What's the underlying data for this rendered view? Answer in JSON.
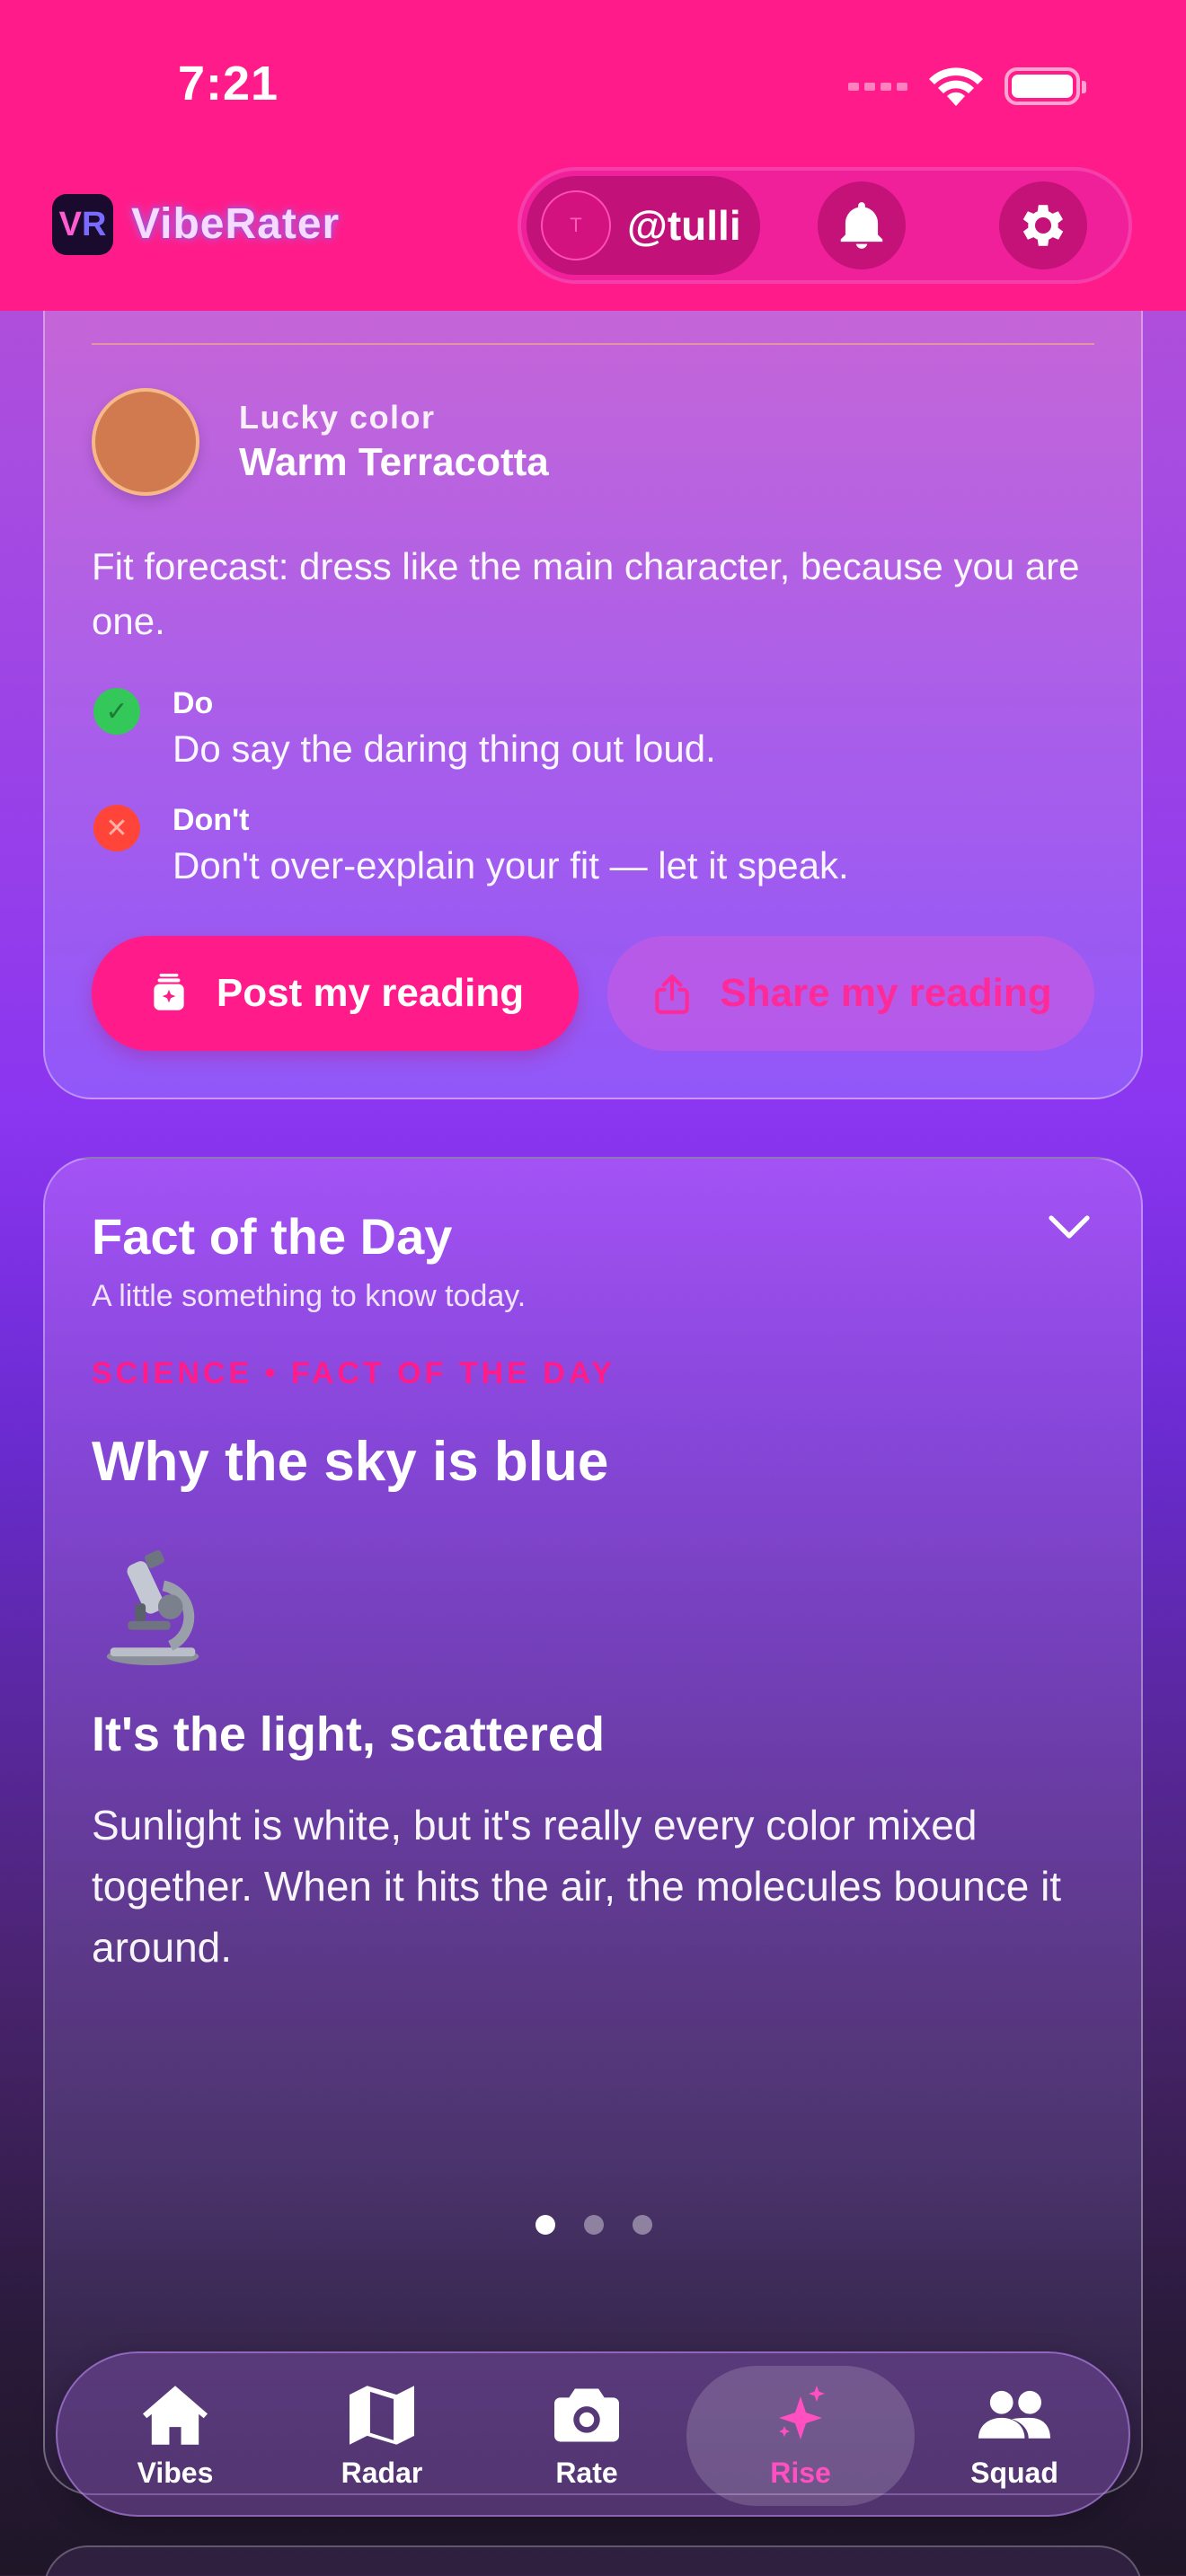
{
  "status_bar": {
    "time": "7:21"
  },
  "header": {
    "app_name": "VibeRater",
    "logo_text": "VR",
    "user": {
      "initial": "T",
      "handle": "@tulli"
    },
    "accent": "#ff1c8a"
  },
  "reading": {
    "lucky_color_label": "Lucky color",
    "lucky_color_value": "Warm Terracotta",
    "lucky_color_hex": "#d27a4f",
    "forecast": "Fit forecast: dress like the main character, because you are one.",
    "do_label": "Do",
    "do_text": "Do say the daring thing out loud.",
    "dont_label": "Don't",
    "dont_text": "Don't over-explain your fit — let it speak.",
    "post_button": "Post my reading",
    "share_button": "Share my reading"
  },
  "fact": {
    "title": "Fact of the Day",
    "subtitle": "A little something to know today.",
    "kicker": "SCIENCE • FACT OF THE DAY",
    "headline": "Why the sky is blue",
    "icon": "microscope-icon",
    "subheadline": "It's the light, scattered",
    "body": "Sunlight is white, but it's really every color mixed together. When it hits the air, the molecules bounce it around.",
    "pager": {
      "current": 1,
      "total": 3
    }
  },
  "tabs": [
    {
      "label": "Vibes",
      "icon": "home-icon",
      "active": false
    },
    {
      "label": "Radar",
      "icon": "map-icon",
      "active": false
    },
    {
      "label": "Rate",
      "icon": "camera-icon",
      "active": false
    },
    {
      "label": "Rise",
      "icon": "sparkles-icon",
      "active": true
    },
    {
      "label": "Squad",
      "icon": "people-icon",
      "active": false
    }
  ]
}
